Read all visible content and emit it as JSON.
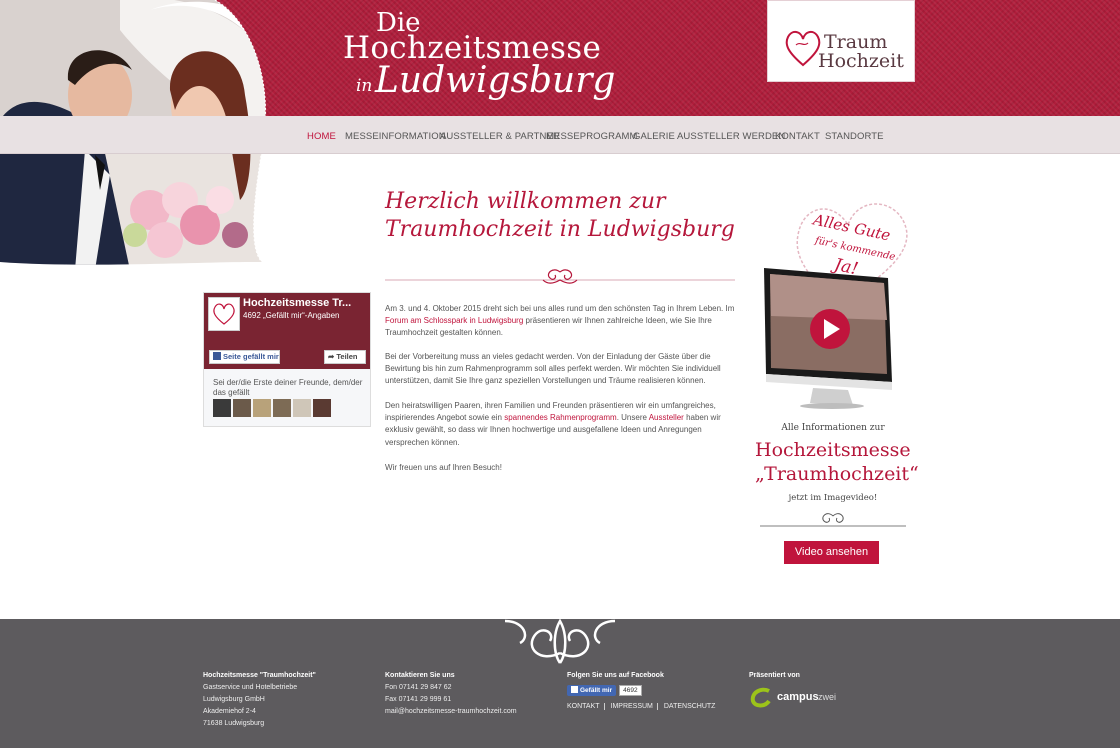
{
  "header": {
    "title_die": "Die",
    "title_main": "Hochzeitsmesse",
    "title_in": "in",
    "title_city": "Ludwigsburg",
    "logo_line1": "Traum",
    "logo_line2": "Hochzeit"
  },
  "nav": {
    "items": [
      "HOME",
      "MESSEINFORMATION",
      "AUSSTELLER & PARTNER",
      "MESSEPROGRAMM",
      "GALERIE",
      "AUSSTELLER WERDEN",
      "KONTAKT",
      "STANDORTE"
    ],
    "active": "HOME"
  },
  "main": {
    "heading_line1": "Herzlich willkommen zur",
    "heading_line2": "Traumhochzeit in Ludwigsburg",
    "p1_a": "Am 3. und 4. Oktober 2015 dreht sich bei uns alles rund um den schönsten Tag in Ihrem Leben. Im ",
    "p1_link": "Forum am Schlosspark in Ludwigsburg",
    "p1_b": " präsentieren wir Ihnen zahlreiche Ideen, wie Sie Ihre Traumhochzeit gestalten können.",
    "p2": "Bei der Vorbereitung muss an vieles gedacht werden. Von der Einladung der Gäste über die Bewirtung bis hin zum Rahmenprogramm soll alles perfekt werden. Wir möchten Sie individuell unterstützen, damit Sie Ihre ganz speziellen Vorstellungen und Träume realisieren können.",
    "p3_a": "Den heiratswilligen Paaren, ihren Familien und Freunden präsentieren wir ein umfangreiches, inspirierendes Angebot sowie ein ",
    "p3_link1": "spannendes Rahmenprogramm",
    "p3_b": ". Unsere ",
    "p3_link2": "Aussteller",
    "p3_c": " haben wir exklusiv gewählt, so dass wir Ihnen hochwertige und ausgefallene Ideen und Anregungen versprechen können.",
    "p4": "Wir freuen uns auf Ihren Besuch!"
  },
  "facebook": {
    "page_name": "Hochzeitsmesse Tr...",
    "likes": "4692 „Gefällt mir“-Angaben",
    "like_btn": "Seite gefällt mir",
    "share_btn": "Teilen",
    "friends_text": "Sei der/die Erste deiner Freunde, dem/der das gefällt"
  },
  "sidebar": {
    "heart_line1": "Alles Gute",
    "heart_line2": "für's kommende",
    "heart_line3": "Ja!",
    "info": "Alle Informationen zur",
    "big1": "Hochzeitsmesse",
    "big2": "„Traumhochzeit“",
    "small": "jetzt im Imagevideo!",
    "button": "Video ansehen"
  },
  "footer": {
    "col1_title": "Hochzeitsmesse \"Traumhochzeit\"",
    "col1_lines": [
      "Gastservice und Hotelbetriebe",
      "Ludwigsburg GmbH",
      "Akademiehof 2-4",
      "71638 Ludwigsburg"
    ],
    "col2_title": "Kontaktieren Sie uns",
    "col2_lines": [
      "Fon 07141 29 847 62",
      "Fax 07141 29 999 61",
      "mail@hochzeitsmesse-traumhochzeit.com"
    ],
    "col3_title": "Folgen Sie uns auf Facebook",
    "fb_like": "Gefällt mir",
    "fb_count": "4692",
    "links": [
      "KONTAKT",
      "IMPRESSUM",
      "DATENSCHUTZ"
    ],
    "col4_title": "Präsentiert von",
    "sponsor_a": "campus",
    "sponsor_b": "zwei"
  },
  "colors": {
    "brand": "#b01d3b",
    "accent": "#c0143c",
    "footer": "#5d5b5e"
  }
}
